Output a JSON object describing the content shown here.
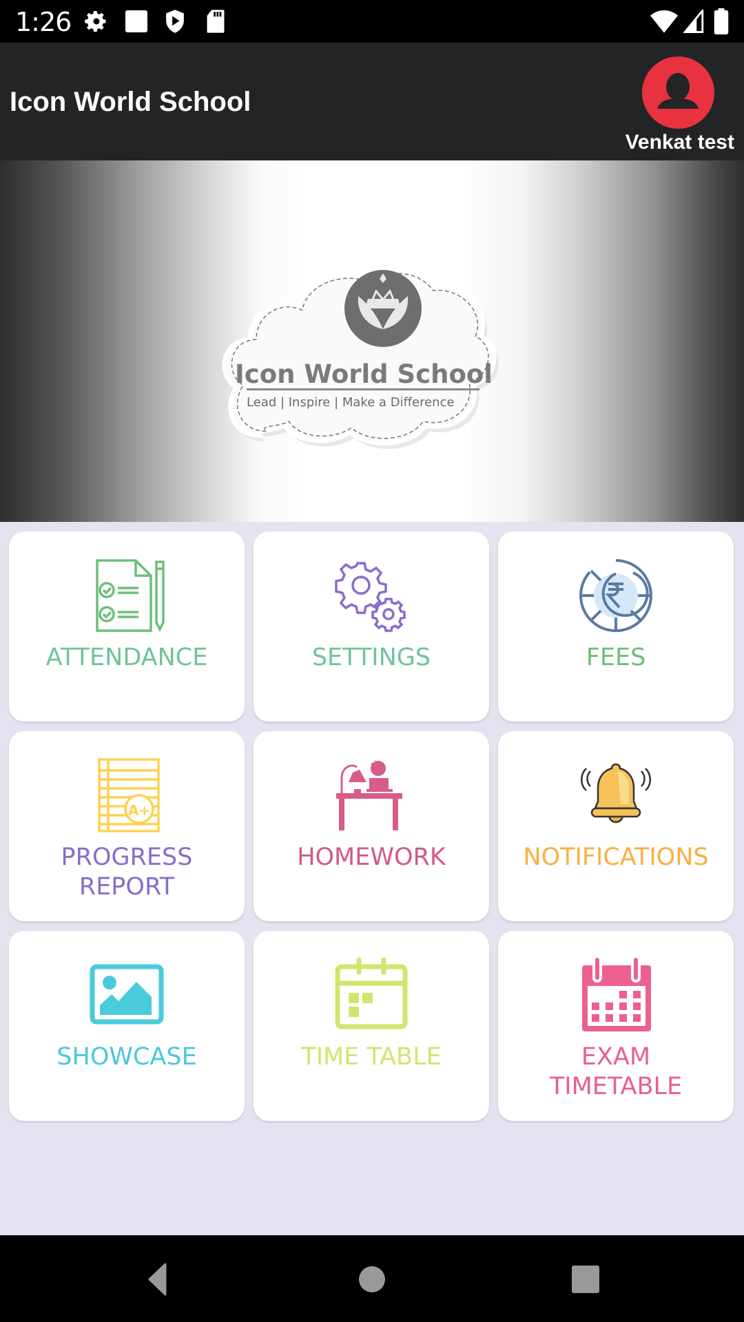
{
  "status_bar": {
    "time": "1:26",
    "left_icons": [
      "settings-icon",
      "square-notification-icon",
      "shield-play-icon",
      "sd-card-icon"
    ],
    "right_icons": [
      "wifi-icon",
      "signal-icon",
      "battery-icon"
    ]
  },
  "app_bar": {
    "title": "Icon World School",
    "user_name": "Venkat test",
    "avatar_color": "#e8323f"
  },
  "banner": {
    "logo_title": "Icon World School",
    "logo_tagline": "Lead | Inspire | Make a Difference"
  },
  "menu": {
    "items": [
      {
        "id": "attendance",
        "label": "ATTENDANCE",
        "icon": "attendance-checklist-icon",
        "label_color": "#6cc59a",
        "icon_color": "#6cbf7a"
      },
      {
        "id": "settings",
        "label": "SETTINGS",
        "icon": "gears-icon",
        "label_color": "#6cc59a",
        "icon_color": "#8a6ad0"
      },
      {
        "id": "fees",
        "label": "FEES",
        "icon": "rupee-coin-icon",
        "label_color": "#6cbf7a",
        "icon_color": "#5b7aa0"
      },
      {
        "id": "progress-report",
        "label": "PROGRESS\nREPORT",
        "label_lines": [
          "PROGRESS",
          "REPORT"
        ],
        "icon": "report-card-icon",
        "label_color": "#8b6cc8",
        "icon_color": "#fdd252"
      },
      {
        "id": "homework",
        "label": "HOMEWORK",
        "icon": "student-desk-icon",
        "label_color": "#d05a86",
        "icon_color": "#d85b89"
      },
      {
        "id": "notifications",
        "label": "NOTIFICATIONS",
        "icon": "bell-icon",
        "label_color": "#f7b041",
        "icon_color": "#f6c35a"
      },
      {
        "id": "showcase",
        "label": "SHOWCASE",
        "icon": "image-icon",
        "label_color": "#4ac8dc",
        "icon_color": "#4acbdc"
      },
      {
        "id": "time-table",
        "label": "TIME TABLE",
        "icon": "calendar-icon",
        "label_color": "#d4e46e",
        "icon_color": "#d4e46e"
      },
      {
        "id": "exam-timetable",
        "label": "EXAM\nTIMETABLE",
        "label_lines": [
          "EXAM",
          "TIMETABLE"
        ],
        "icon": "exam-calendar-icon",
        "label_color": "#e8608c",
        "icon_color": "#ec6090"
      }
    ]
  },
  "nav_bar": {
    "back": "back-icon",
    "home": "home-icon",
    "recents": "recents-icon"
  }
}
